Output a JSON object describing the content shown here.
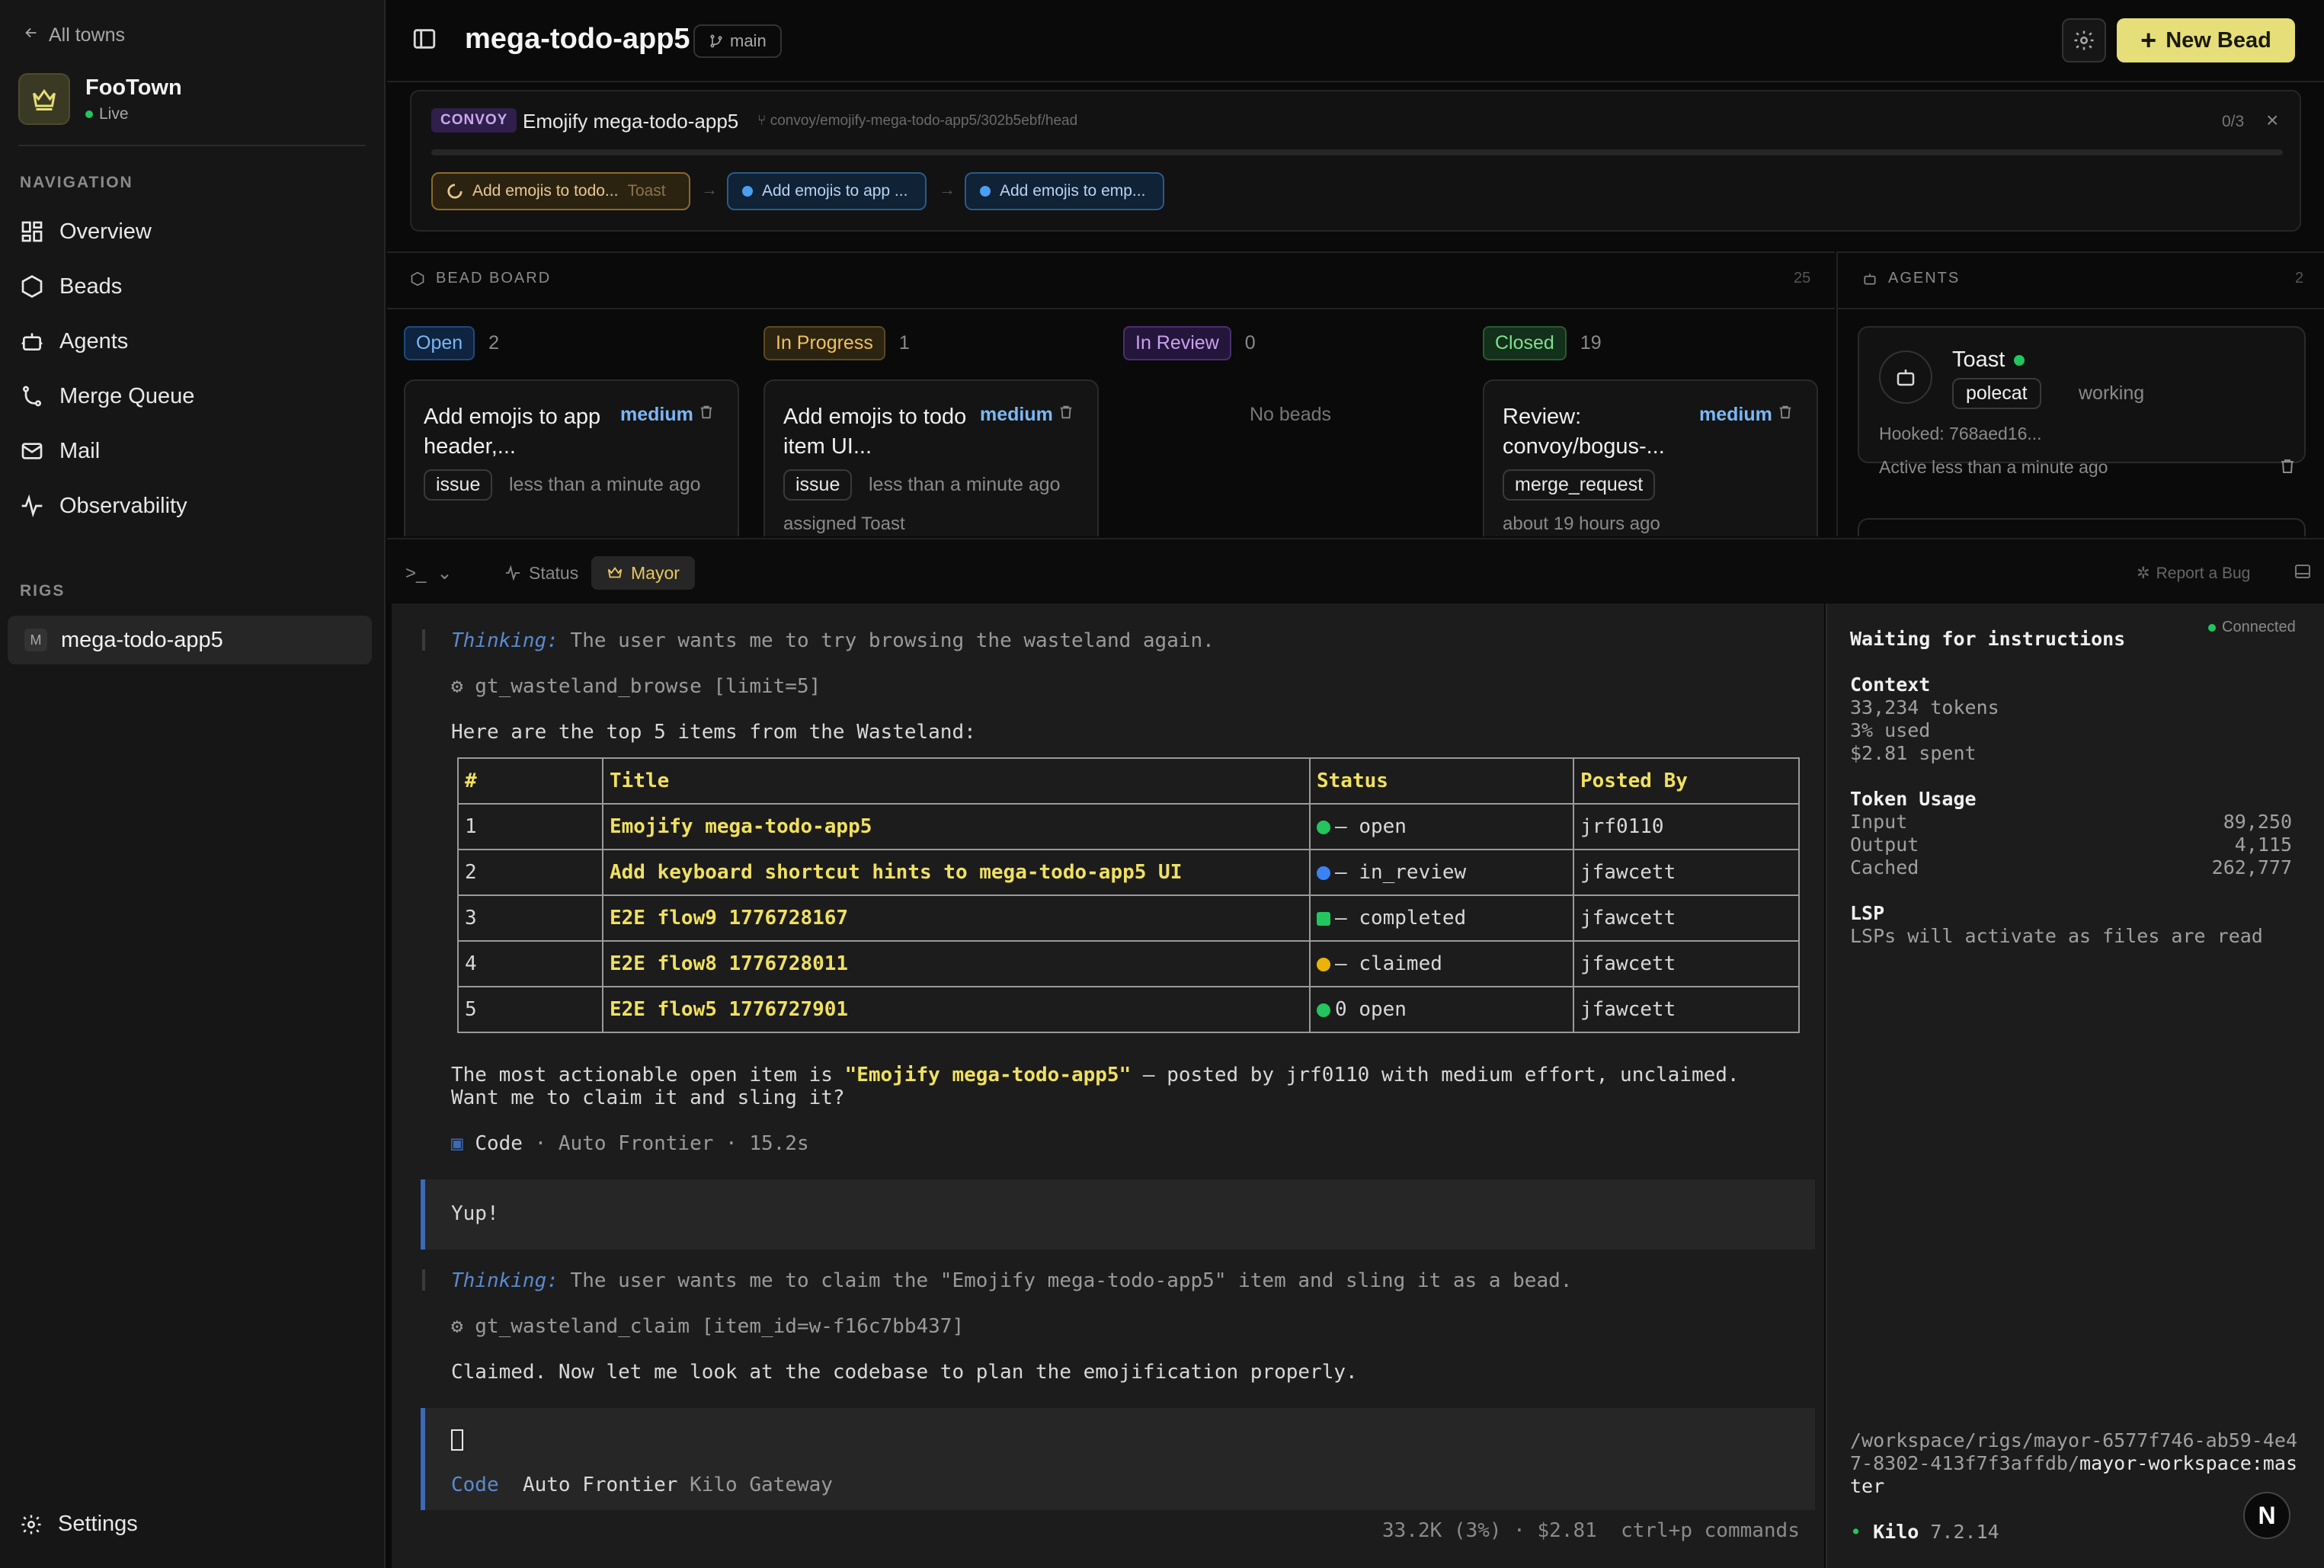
{
  "sidebar": {
    "back_label": "All towns",
    "town_name": "FooTown",
    "town_status": "Live",
    "nav_section": "NAVIGATION",
    "nav_items": [
      {
        "label": "Overview",
        "icon": "grid-icon"
      },
      {
        "label": "Beads",
        "icon": "hexagon-icon"
      },
      {
        "label": "Agents",
        "icon": "robot-icon"
      },
      {
        "label": "Merge Queue",
        "icon": "git-merge-icon"
      },
      {
        "label": "Mail",
        "icon": "mail-icon"
      },
      {
        "label": "Observability",
        "icon": "activity-icon"
      }
    ],
    "rigs_section": "RIGS",
    "rig_badge": "M",
    "rig_name": "mega-todo-app5",
    "settings_label": "Settings"
  },
  "topbar": {
    "title": "mega-todo-app5",
    "branch": "main",
    "new_bead_label": "New Bead"
  },
  "convoy": {
    "tag": "CONVOY",
    "name": "Emojify mega-todo-app5",
    "path": "convoy/emojify-mega-todo-app5/302b5ebf/head",
    "count": "0/3",
    "steps": [
      {
        "label": "Add emojis to todo...",
        "assignee": "Toast"
      },
      {
        "label": "Add emojis to app ..."
      },
      {
        "label": "Add emojis to emp..."
      }
    ]
  },
  "beadboard": {
    "title": "BEAD BOARD",
    "count": "25",
    "columns": [
      {
        "label": "Open",
        "count": "2"
      },
      {
        "label": "In Progress",
        "count": "1"
      },
      {
        "label": "In Review",
        "count": "0"
      },
      {
        "label": "Closed",
        "count": "19"
      }
    ],
    "cards": [
      {
        "title": "Add emojis to app header,...",
        "priority": "medium",
        "tag": "issue",
        "time": "less than a minute ago"
      },
      {
        "title": "Add emojis to todo item UI...",
        "priority": "medium",
        "tag": "issue",
        "time": "less than a minute ago",
        "meta": "assigned Toast"
      },
      {
        "title": "Review: convoy/bogus-...",
        "priority": "medium",
        "tag": "merge_request",
        "meta": "about 19 hours ago"
      }
    ],
    "empty_label": "No beads"
  },
  "agents": {
    "title": "AGENTS",
    "count": "2",
    "agent": {
      "name": "Toast",
      "role": "polecat",
      "state": "working",
      "hooked": "Hooked: 768aed16...",
      "active": "Active less than a minute ago"
    },
    "status_color": "#22c55e"
  },
  "termbar": {
    "tab_status": "Status",
    "tab_mayor": "Mayor",
    "report_bug": "Report a Bug"
  },
  "terminal": {
    "think1_label": "Thinking:",
    "think1_text": " The user wants me to try browsing the wasteland again.",
    "tool1": "⚙ gt_wasteland_browse [limit=5]",
    "intro": "Here are the top 5 items from the Wasteland:",
    "table_headers": [
      "#",
      "Title",
      "Status",
      "Posted By"
    ],
    "table_rows": [
      {
        "num": "1",
        "title": "Emojify mega-todo-app5",
        "status": "open",
        "status_color": "#22c55e",
        "glyph": "–",
        "by": "jrf0110"
      },
      {
        "num": "2",
        "title": "Add keyboard shortcut hints to mega-todo-app5 UI",
        "status": "in_review",
        "status_color": "#3b82f6",
        "glyph": "–",
        "by": "jfawcett"
      },
      {
        "num": "3",
        "title": "E2E flow9 1776728167",
        "status": "completed",
        "status_color": "#22c55e",
        "glyph": "–",
        "by": "jfawcett"
      },
      {
        "num": "4",
        "title": "E2E flow8 1776728011",
        "status": "claimed",
        "status_color": "#eab308",
        "glyph": "–",
        "by": "jfawcett"
      },
      {
        "num": "5",
        "title": "E2E flow5 1776727901",
        "status": "open",
        "status_color": "#22c55e",
        "glyph": "0",
        "by": "jfawcett"
      }
    ],
    "summary_prefix": "The most actionable open item is ",
    "summary_highlight": "\"Emojify mega-todo-app5\"",
    "summary_suffix": " — posted by jrf0110 with medium effort, unclaimed.",
    "summary_line2": "Want me to claim it and sling it?",
    "meta1_label": "Code",
    "meta1_rest": " · Auto Frontier · 15.2s",
    "user_msg": "Yup!",
    "think2_label": "Thinking:",
    "think2_text": " The user wants me to claim the \"Emojify mega-todo-app5\" item and sling it as a bead.",
    "tool2": "⚙ gt_wasteland_claim [item_id=w-f16c7bb437]",
    "claimed": "Claimed. Now let me look at the codebase to plan the emojification properly.",
    "input_mode": "Code",
    "input_model": "Auto Frontier",
    "input_provider": "Kilo Gateway",
    "status_line": "33.2K (3%) · $2.81  ctrl+p commands"
  },
  "info": {
    "connected": "Connected",
    "waiting": "Waiting for instructions",
    "context_h": "Context",
    "tokens": "33,234 tokens",
    "used": "3% used",
    "spent": "$2.81 spent",
    "usage_h": "Token Usage",
    "input_label": "Input",
    "input_val": "89,250",
    "output_label": "Output",
    "output_val": "4,115",
    "cached_label": "Cached",
    "cached_val": "262,777",
    "lsp_h": "LSP",
    "lsp_text": "LSPs will activate as files are read",
    "path_prefix": "/workspace/rigs/mayor-6577f746-ab59-4e47-8302-413f7f3affdb/",
    "path_suffix": "mayor-workspace:master",
    "app_name": "Kilo",
    "app_version": " 7.2.14",
    "n_badge": "N"
  },
  "colors": {
    "accent_yellow": "#e6de78",
    "live_green": "#22c55e"
  }
}
